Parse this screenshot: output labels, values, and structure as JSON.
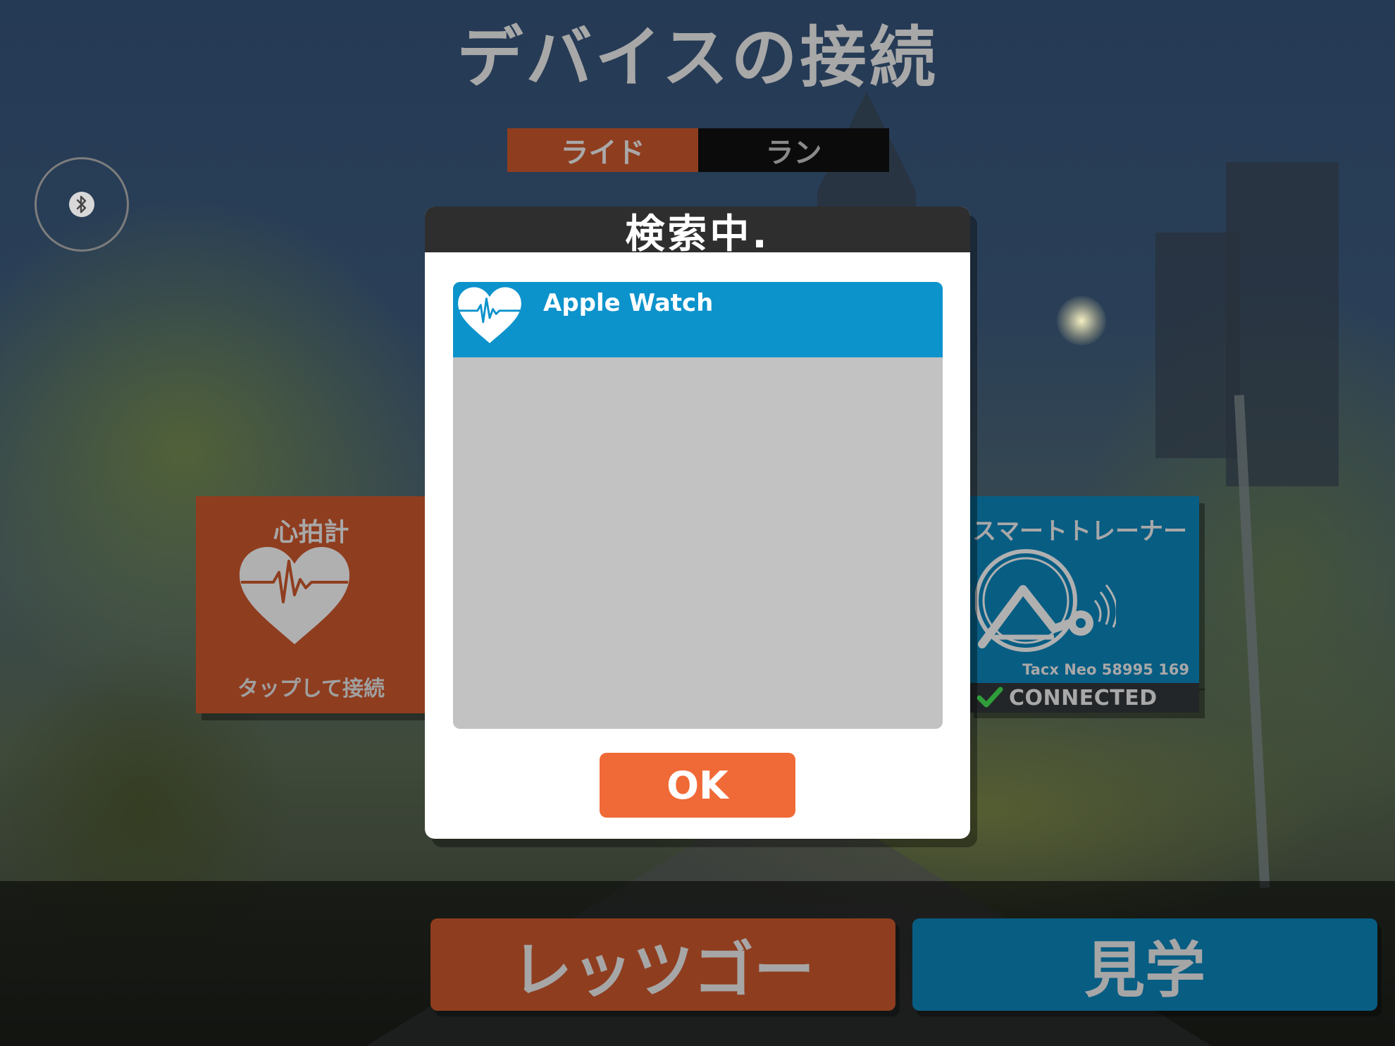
{
  "title": "デバイスの接続",
  "mode_tabs": [
    {
      "label": "ライド",
      "active": true
    },
    {
      "label": "ラン",
      "active": false
    }
  ],
  "bluetooth": {
    "icon": "bluetooth-icon"
  },
  "heart_rate_tile": {
    "title": "心拍計",
    "status": "タップして接続",
    "icon": "heart-pulse-icon",
    "color": "#8f3d1f"
  },
  "trainer_tile": {
    "title": "スマートトレーナー",
    "device_name": "Tacx Neo 58995 169",
    "status": "CONNECTED",
    "icon": "smart-trainer-icon",
    "status_icon": "check-icon",
    "color": "#085d83"
  },
  "modal": {
    "title": "検索中.",
    "devices": [
      {
        "name": "Apple Watch",
        "icon": "heart-pulse-icon"
      }
    ],
    "ok_label": "OK",
    "accent": "#0d93cc",
    "ok_color": "#f06a37"
  },
  "actions": {
    "lets_go": "レッツゴー",
    "spectate": "見学"
  }
}
